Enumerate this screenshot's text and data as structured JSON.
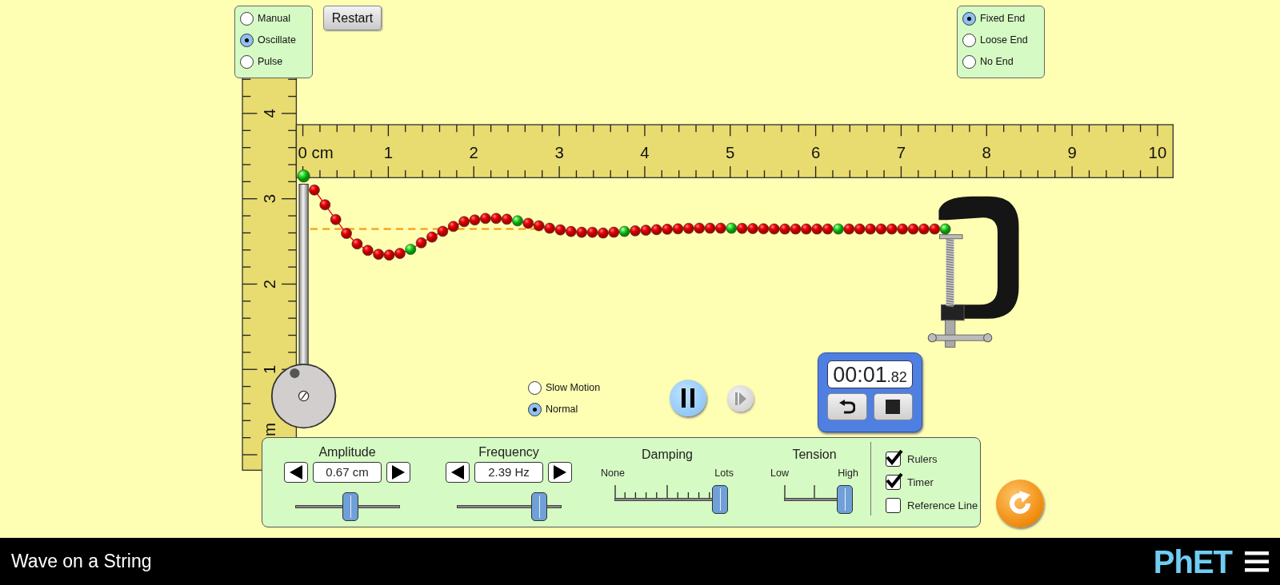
{
  "mode_options": [
    {
      "label": "Manual",
      "selected": false
    },
    {
      "label": "Oscillate",
      "selected": true
    },
    {
      "label": "Pulse",
      "selected": false
    }
  ],
  "restart_button": "Restart",
  "end_options": [
    {
      "label": "Fixed End",
      "selected": true
    },
    {
      "label": "Loose End",
      "selected": false
    },
    {
      "label": "No End",
      "selected": false
    }
  ],
  "horizontal_ruler": {
    "labels": [
      "0 cm",
      "1",
      "2",
      "3",
      "4",
      "5",
      "6",
      "7",
      "8",
      "9",
      "10"
    ]
  },
  "vertical_ruler": {
    "unit": "m",
    "labels": [
      "1",
      "2",
      "3",
      "4"
    ]
  },
  "speed_options": [
    {
      "label": "Slow Motion",
      "selected": false
    },
    {
      "label": "Normal",
      "selected": true
    }
  ],
  "playback": {
    "playing": true,
    "step_disabled": true
  },
  "timer": {
    "time": "00:01",
    "fraction": ".82"
  },
  "controls": {
    "spinners": [
      {
        "label": "Amplitude",
        "value": "0.67 cm",
        "level": 0.53
      },
      {
        "label": "Frequency",
        "value": "2.39 Hz",
        "level": 0.79
      }
    ],
    "sliders": [
      {
        "label": "Damping",
        "min_label": "None",
        "max_label": "Lots",
        "level": 1.0
      },
      {
        "label": "Tension",
        "min_label": "Low",
        "max_label": "High",
        "level": 1.0
      }
    ],
    "checkboxes": [
      {
        "label": "Rulers",
        "checked": true
      },
      {
        "label": "Timer",
        "checked": true
      },
      {
        "label": "Reference Line",
        "checked": false
      }
    ]
  },
  "app_title": "Wave on a String",
  "logo": "PhET"
}
